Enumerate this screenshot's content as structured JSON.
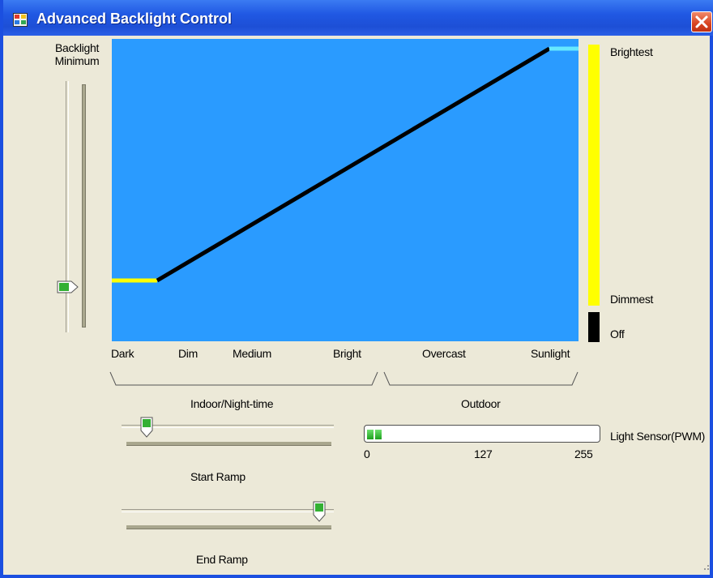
{
  "window": {
    "title": "Advanced Backlight Control",
    "icons": {
      "app": "app-window-icon",
      "close": "close-icon"
    }
  },
  "backlight_minimum": {
    "label_line1": "Backlight",
    "label_line2": "Minimum",
    "value_fraction": 0.18
  },
  "curve": {
    "line_color": "#000000",
    "low_segment_color": "#ffff00",
    "high_segment_color": "#66e8ff",
    "background_color": "#2a9bff"
  },
  "brightness_scale": {
    "top_label": "Brightest",
    "bottom_label": "Dimmest",
    "off_label": "Off",
    "on_color": "#ffff00",
    "off_color": "#000000"
  },
  "light_levels": [
    "Dark",
    "Dim",
    "Medium",
    "Bright",
    "Overcast",
    "Sunlight"
  ],
  "groups": {
    "indoor": "Indoor/Night-time",
    "outdoor": "Outdoor"
  },
  "start_ramp": {
    "label": "Start Ramp",
    "value_fraction": 0.12
  },
  "end_ramp": {
    "label": "End Ramp",
    "value_fraction": 0.93
  },
  "light_sensor": {
    "label": "Light Sensor(PWM)",
    "tick_min": "0",
    "tick_mid": "127",
    "tick_max": "255",
    "value_fraction": 0.07
  }
}
